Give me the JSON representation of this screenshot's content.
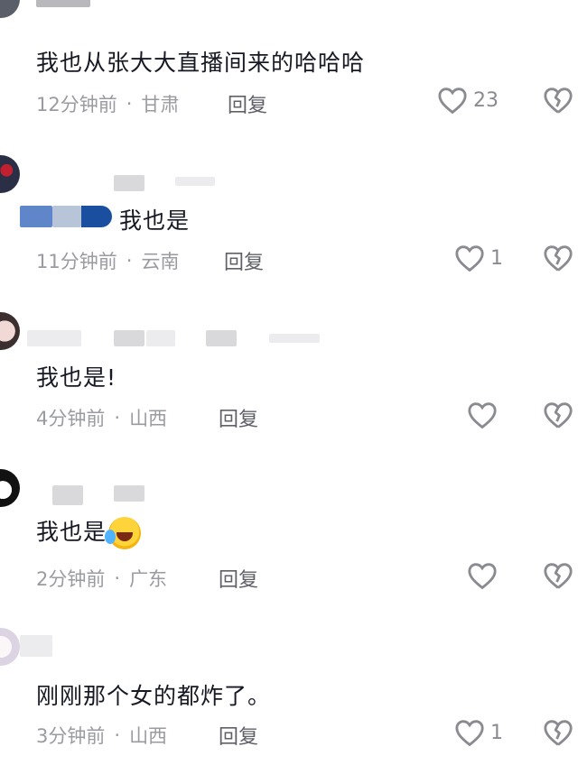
{
  "comments": [
    {
      "body": "我也从张大大直播间来的哈哈哈",
      "time": "12分钟前",
      "location": "甘肃",
      "reply": "回复",
      "likes": "23"
    },
    {
      "body": "我也是",
      "time": "11分钟前",
      "location": "云南",
      "reply": "回复",
      "likes": "1"
    },
    {
      "body": "我也是!",
      "time": "4分钟前",
      "location": "山西",
      "reply": "回复",
      "likes": ""
    },
    {
      "body": "我也是",
      "time": "2分钟前",
      "location": "广东",
      "reply": "回复",
      "likes": ""
    },
    {
      "body": "刚刚那个女的都炸了。",
      "time": "3分钟前",
      "location": "山西",
      "reply": "回复",
      "likes": "1"
    }
  ],
  "meta_separator": "·",
  "icons": {
    "like": "heart-outline-icon",
    "dislike": "broken-heart-icon",
    "emoji": "laughing-crying-emoji"
  },
  "colors": {
    "text": "#161823",
    "meta": "#9a9ba1",
    "icon": "#8a8b91"
  }
}
